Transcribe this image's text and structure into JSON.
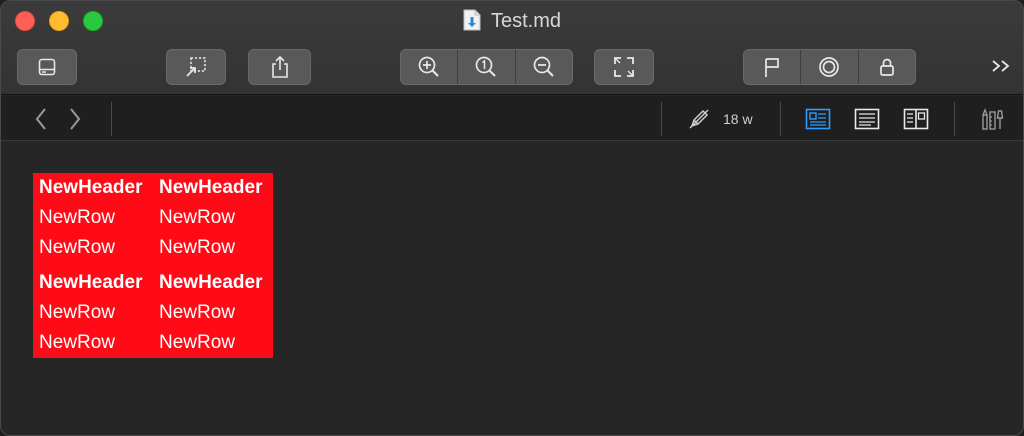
{
  "window": {
    "title": "Test.md"
  },
  "toolbar": {
    "buttons": [
      {
        "name": "sidebar-toggle",
        "icon": "sidebar-icon"
      },
      {
        "name": "select-region",
        "icon": "select-region-icon"
      },
      {
        "name": "share",
        "icon": "share-icon"
      },
      {
        "name": "zoom-in",
        "icon": "zoom-in-icon"
      },
      {
        "name": "actual-size",
        "icon": "actual-size-icon",
        "icon_label": "1"
      },
      {
        "name": "zoom-out",
        "icon": "zoom-out-icon"
      },
      {
        "name": "full-screen",
        "icon": "full-screen-icon"
      },
      {
        "name": "flag",
        "icon": "flag-icon"
      },
      {
        "name": "target",
        "icon": "target-icon"
      },
      {
        "name": "lock",
        "icon": "lock-icon"
      },
      {
        "name": "overflow",
        "icon": "chevron-double-right-icon"
      }
    ]
  },
  "subbar": {
    "word_count": "18 w",
    "icons": [
      "chevron-left-icon",
      "chevron-right-icon",
      "pencil-icon",
      "preview-mode-icon",
      "text-mode-icon",
      "split-mode-icon",
      "style-tools-icon"
    ],
    "active_mode": "preview-mode",
    "accent_color": "#2f9dfd"
  },
  "preview": {
    "background_color": "#ff0a17",
    "text_color": "#ffffff",
    "rows": [
      {
        "type": "header",
        "cells": [
          "NewHeader",
          "NewHeader"
        ]
      },
      {
        "type": "row",
        "cells": [
          "NewRow",
          "NewRow"
        ]
      },
      {
        "type": "row",
        "cells": [
          "NewRow",
          "NewRow"
        ]
      },
      {
        "type": "header",
        "cells": [
          "NewHeader",
          "NewHeader"
        ]
      },
      {
        "type": "row",
        "cells": [
          "NewRow",
          "NewRow"
        ]
      },
      {
        "type": "row",
        "cells": [
          "NewRow",
          "NewRow"
        ]
      }
    ]
  }
}
